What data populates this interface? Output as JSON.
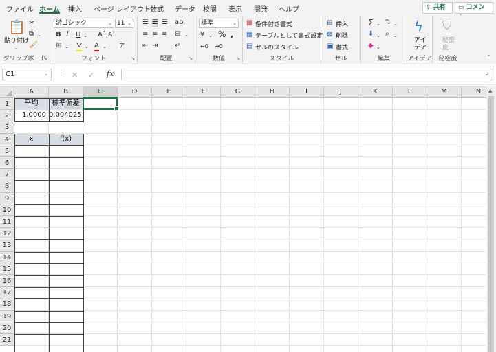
{
  "menu": {
    "tabs": [
      "ファイル",
      "ホーム",
      "挿入",
      "ページ レイアウト",
      "数式",
      "データ",
      "校閲",
      "表示",
      "開発",
      "ヘルプ"
    ],
    "active": "ホーム",
    "share": "共有",
    "comment": "コメント"
  },
  "ribbon": {
    "clipboard": {
      "label": "クリップボード",
      "paste": "貼り付け"
    },
    "font": {
      "label": "フォント",
      "name": "游ゴシック",
      "size": "11"
    },
    "alignment": {
      "label": "配置"
    },
    "number": {
      "label": "数値",
      "format": "標準"
    },
    "styles": {
      "label": "スタイル",
      "conditional": "条件付き書式",
      "table": "テーブルとして書式設定",
      "cell_style": "セルのスタイル"
    },
    "cells": {
      "label": "セル",
      "insert": "挿入",
      "delete": "削除",
      "format": "書式"
    },
    "editing": {
      "label": "編集"
    },
    "ideas": {
      "label": "アイデア",
      "button_line1": "アイ",
      "button_line2": "デア"
    },
    "sensitivity": {
      "label": "秘密度",
      "button_line1": "秘密",
      "button_line2": "度"
    }
  },
  "formula_bar": {
    "name_box": "C1",
    "fx": "fx",
    "value": ""
  },
  "sheet": {
    "columns": [
      "A",
      "B",
      "C",
      "D",
      "E",
      "F",
      "G",
      "H",
      "I",
      "J",
      "K",
      "L",
      "M",
      "N"
    ],
    "selected_column": "C",
    "rows": [
      "1",
      "2",
      "3",
      "4",
      "5",
      "6",
      "7",
      "8",
      "9",
      "10",
      "11",
      "12",
      "13",
      "14",
      "15",
      "16",
      "17",
      "18",
      "19",
      "20",
      "21"
    ],
    "cells": {
      "A1": "平均",
      "B1": "標準偏差",
      "A2": "1.0000",
      "B2": "0.004025",
      "A4": "x",
      "B4": "f(x)"
    },
    "header_fill": "#d6dce4",
    "accent": "#1e7145"
  }
}
